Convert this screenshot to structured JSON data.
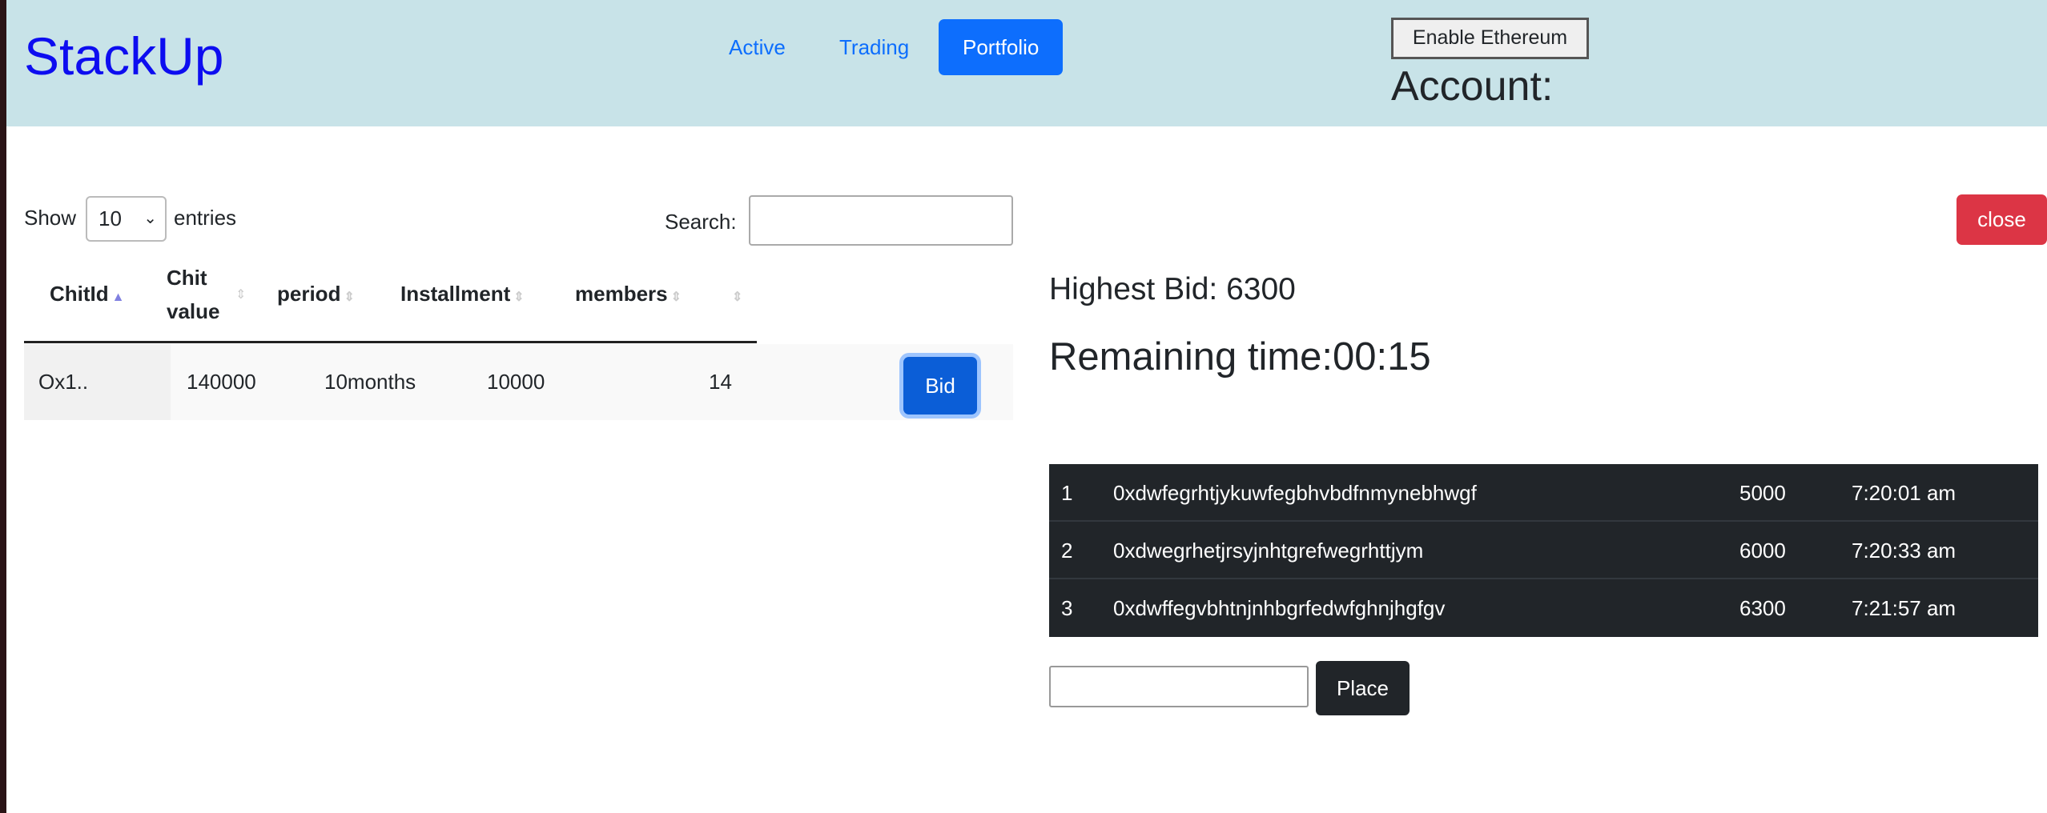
{
  "header": {
    "logo": "StackUp",
    "nav": [
      "Active",
      "Trading",
      "Portfolio"
    ],
    "active_nav": "Portfolio",
    "enable_button": "Enable Ethereum",
    "account_label": "Account:"
  },
  "table_controls": {
    "show": "Show",
    "entries_value": "10",
    "entries": "entries",
    "search_label": "Search:",
    "search_value": ""
  },
  "table": {
    "columns": [
      "ChitId",
      "Chit value",
      "period",
      "Installment",
      "members",
      ""
    ],
    "rows": [
      {
        "chit_id": "Ox1..",
        "chit_value": "140000",
        "period": "10months",
        "installment": "10000",
        "members": "14",
        "action": "Bid"
      }
    ]
  },
  "auction": {
    "close_label": "close",
    "highest_bid": "Highest Bid: 6300",
    "remaining_time": "Remaining time:00:15",
    "bids": [
      {
        "n": "1",
        "address": "0xdwfegrhtjykuwfegbhvbdfnmynebhwgf",
        "amount": "5000",
        "time": "7:20:01 am"
      },
      {
        "n": "2",
        "address": "0xdwegrhetjrsyjnhtgrefwegrhttjym",
        "amount": "6000",
        "time": "7:20:33 am"
      },
      {
        "n": "3",
        "address": "0xdwffegvbhtnjnhbgrfedwfghnjhgfgv",
        "amount": "6300",
        "time": "7:21:57 am"
      }
    ],
    "bid_input_value": "",
    "place_label": "Place"
  },
  "colors": {
    "header_bg": "#c8e3e8",
    "primary": "#0d6efd",
    "danger": "#dc3545",
    "dark": "#212529",
    "logo": "#0d0df0"
  }
}
